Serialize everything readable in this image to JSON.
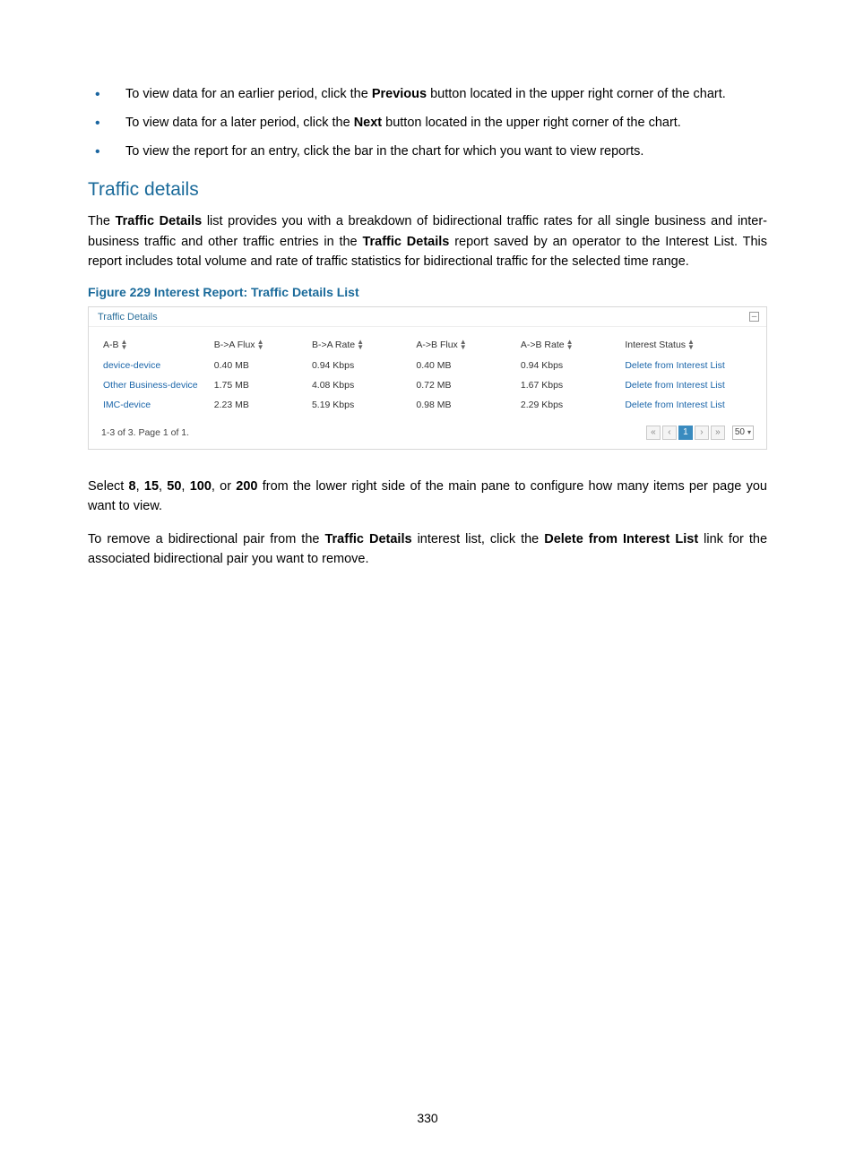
{
  "bullets": {
    "b1_pre": "To view data for an earlier period, click the ",
    "b1_bold": "Previous",
    "b1_post": " button located in the upper right corner of the chart.",
    "b2_pre": "To view data for a later period, click the ",
    "b2_bold": "Next",
    "b2_post": " button located in the upper right corner of the chart.",
    "b3": "To view the report for an entry, click the bar in the chart for which you want to view reports."
  },
  "heading": "Traffic details",
  "para1_pre": "The ",
  "para1_b1": "Traffic Details",
  "para1_mid": " list provides you with a breakdown of bidirectional traffic rates for all single business and inter-business traffic and other traffic entries in the ",
  "para1_b2": "Traffic Details",
  "para1_post": " report saved by an operator to the Interest List. This report includes total volume and rate of traffic statistics for bidirectional traffic for the selected time range.",
  "figure_caption": "Figure 229 Interest Report: Traffic Details List",
  "panel_title": "Traffic Details",
  "collapse_glyph": "–",
  "columns": {
    "c1": "A-B",
    "c2": "B->A Flux",
    "c3": "B->A Rate",
    "c4": "A->B Flux",
    "c5": "A->B Rate",
    "c6": "Interest Status"
  },
  "rows": [
    {
      "ab": "device-device",
      "ba_flux": "0.40 MB",
      "ba_rate": "0.94 Kbps",
      "ab_flux": "0.40 MB",
      "ab_rate": "0.94 Kbps",
      "action": "Delete from Interest List"
    },
    {
      "ab": "Other Business-device",
      "ba_flux": "1.75 MB",
      "ba_rate": "4.08 Kbps",
      "ab_flux": "0.72 MB",
      "ab_rate": "1.67 Kbps",
      "action": "Delete from Interest List"
    },
    {
      "ab": "IMC-device",
      "ba_flux": "2.23 MB",
      "ba_rate": "5.19 Kbps",
      "ab_flux": "0.98 MB",
      "ab_rate": "2.29 Kbps",
      "action": "Delete from Interest List"
    }
  ],
  "footer_range": "1-3 of 3. Page 1 of 1.",
  "pager": {
    "first": "«",
    "prev": "‹",
    "current": "1",
    "next": "›",
    "last": "»",
    "size": "50"
  },
  "para2_pre": "Select ",
  "para2_b1": "8",
  "para2_c1": ", ",
  "para2_b2": "15",
  "para2_c2": ", ",
  "para2_b3": "50",
  "para2_c3": ", ",
  "para2_b4": "100",
  "para2_c4": ", or ",
  "para2_b5": "200",
  "para2_post": " from the lower right side of the main pane to configure how many items per page you want to view.",
  "para3_pre": "To remove a bidirectional pair from the ",
  "para3_b1": "Traffic Details",
  "para3_mid": " interest list, click the ",
  "para3_b2": "Delete from Interest List",
  "para3_post": " link for the associated bidirectional pair you want to remove.",
  "page_number": "330"
}
